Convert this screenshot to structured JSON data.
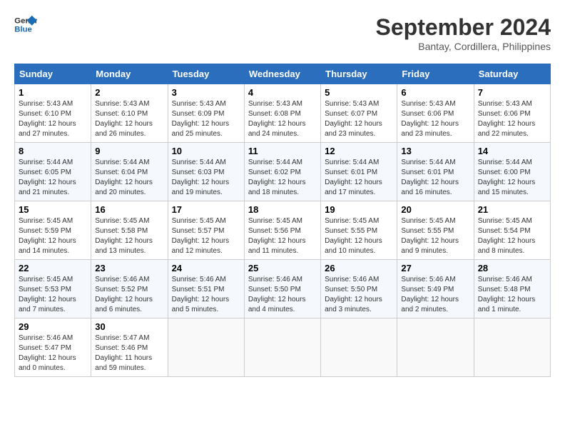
{
  "header": {
    "logo_line1": "General",
    "logo_line2": "Blue",
    "month": "September 2024",
    "location": "Bantay, Cordillera, Philippines"
  },
  "columns": [
    "Sunday",
    "Monday",
    "Tuesday",
    "Wednesday",
    "Thursday",
    "Friday",
    "Saturday"
  ],
  "weeks": [
    [
      {
        "day": "1",
        "info": "Sunrise: 5:43 AM\nSunset: 6:10 PM\nDaylight: 12 hours\nand 27 minutes."
      },
      {
        "day": "2",
        "info": "Sunrise: 5:43 AM\nSunset: 6:10 PM\nDaylight: 12 hours\nand 26 minutes."
      },
      {
        "day": "3",
        "info": "Sunrise: 5:43 AM\nSunset: 6:09 PM\nDaylight: 12 hours\nand 25 minutes."
      },
      {
        "day": "4",
        "info": "Sunrise: 5:43 AM\nSunset: 6:08 PM\nDaylight: 12 hours\nand 24 minutes."
      },
      {
        "day": "5",
        "info": "Sunrise: 5:43 AM\nSunset: 6:07 PM\nDaylight: 12 hours\nand 23 minutes."
      },
      {
        "day": "6",
        "info": "Sunrise: 5:43 AM\nSunset: 6:06 PM\nDaylight: 12 hours\nand 23 minutes."
      },
      {
        "day": "7",
        "info": "Sunrise: 5:43 AM\nSunset: 6:06 PM\nDaylight: 12 hours\nand 22 minutes."
      }
    ],
    [
      {
        "day": "8",
        "info": "Sunrise: 5:44 AM\nSunset: 6:05 PM\nDaylight: 12 hours\nand 21 minutes."
      },
      {
        "day": "9",
        "info": "Sunrise: 5:44 AM\nSunset: 6:04 PM\nDaylight: 12 hours\nand 20 minutes."
      },
      {
        "day": "10",
        "info": "Sunrise: 5:44 AM\nSunset: 6:03 PM\nDaylight: 12 hours\nand 19 minutes."
      },
      {
        "day": "11",
        "info": "Sunrise: 5:44 AM\nSunset: 6:02 PM\nDaylight: 12 hours\nand 18 minutes."
      },
      {
        "day": "12",
        "info": "Sunrise: 5:44 AM\nSunset: 6:01 PM\nDaylight: 12 hours\nand 17 minutes."
      },
      {
        "day": "13",
        "info": "Sunrise: 5:44 AM\nSunset: 6:01 PM\nDaylight: 12 hours\nand 16 minutes."
      },
      {
        "day": "14",
        "info": "Sunrise: 5:44 AM\nSunset: 6:00 PM\nDaylight: 12 hours\nand 15 minutes."
      }
    ],
    [
      {
        "day": "15",
        "info": "Sunrise: 5:45 AM\nSunset: 5:59 PM\nDaylight: 12 hours\nand 14 minutes."
      },
      {
        "day": "16",
        "info": "Sunrise: 5:45 AM\nSunset: 5:58 PM\nDaylight: 12 hours\nand 13 minutes."
      },
      {
        "day": "17",
        "info": "Sunrise: 5:45 AM\nSunset: 5:57 PM\nDaylight: 12 hours\nand 12 minutes."
      },
      {
        "day": "18",
        "info": "Sunrise: 5:45 AM\nSunset: 5:56 PM\nDaylight: 12 hours\nand 11 minutes."
      },
      {
        "day": "19",
        "info": "Sunrise: 5:45 AM\nSunset: 5:55 PM\nDaylight: 12 hours\nand 10 minutes."
      },
      {
        "day": "20",
        "info": "Sunrise: 5:45 AM\nSunset: 5:55 PM\nDaylight: 12 hours\nand 9 minutes."
      },
      {
        "day": "21",
        "info": "Sunrise: 5:45 AM\nSunset: 5:54 PM\nDaylight: 12 hours\nand 8 minutes."
      }
    ],
    [
      {
        "day": "22",
        "info": "Sunrise: 5:45 AM\nSunset: 5:53 PM\nDaylight: 12 hours\nand 7 minutes."
      },
      {
        "day": "23",
        "info": "Sunrise: 5:46 AM\nSunset: 5:52 PM\nDaylight: 12 hours\nand 6 minutes."
      },
      {
        "day": "24",
        "info": "Sunrise: 5:46 AM\nSunset: 5:51 PM\nDaylight: 12 hours\nand 5 minutes."
      },
      {
        "day": "25",
        "info": "Sunrise: 5:46 AM\nSunset: 5:50 PM\nDaylight: 12 hours\nand 4 minutes."
      },
      {
        "day": "26",
        "info": "Sunrise: 5:46 AM\nSunset: 5:50 PM\nDaylight: 12 hours\nand 3 minutes."
      },
      {
        "day": "27",
        "info": "Sunrise: 5:46 AM\nSunset: 5:49 PM\nDaylight: 12 hours\nand 2 minutes."
      },
      {
        "day": "28",
        "info": "Sunrise: 5:46 AM\nSunset: 5:48 PM\nDaylight: 12 hours\nand 1 minute."
      }
    ],
    [
      {
        "day": "29",
        "info": "Sunrise: 5:46 AM\nSunset: 5:47 PM\nDaylight: 12 hours\nand 0 minutes."
      },
      {
        "day": "30",
        "info": "Sunrise: 5:47 AM\nSunset: 5:46 PM\nDaylight: 11 hours\nand 59 minutes."
      },
      null,
      null,
      null,
      null,
      null
    ]
  ]
}
